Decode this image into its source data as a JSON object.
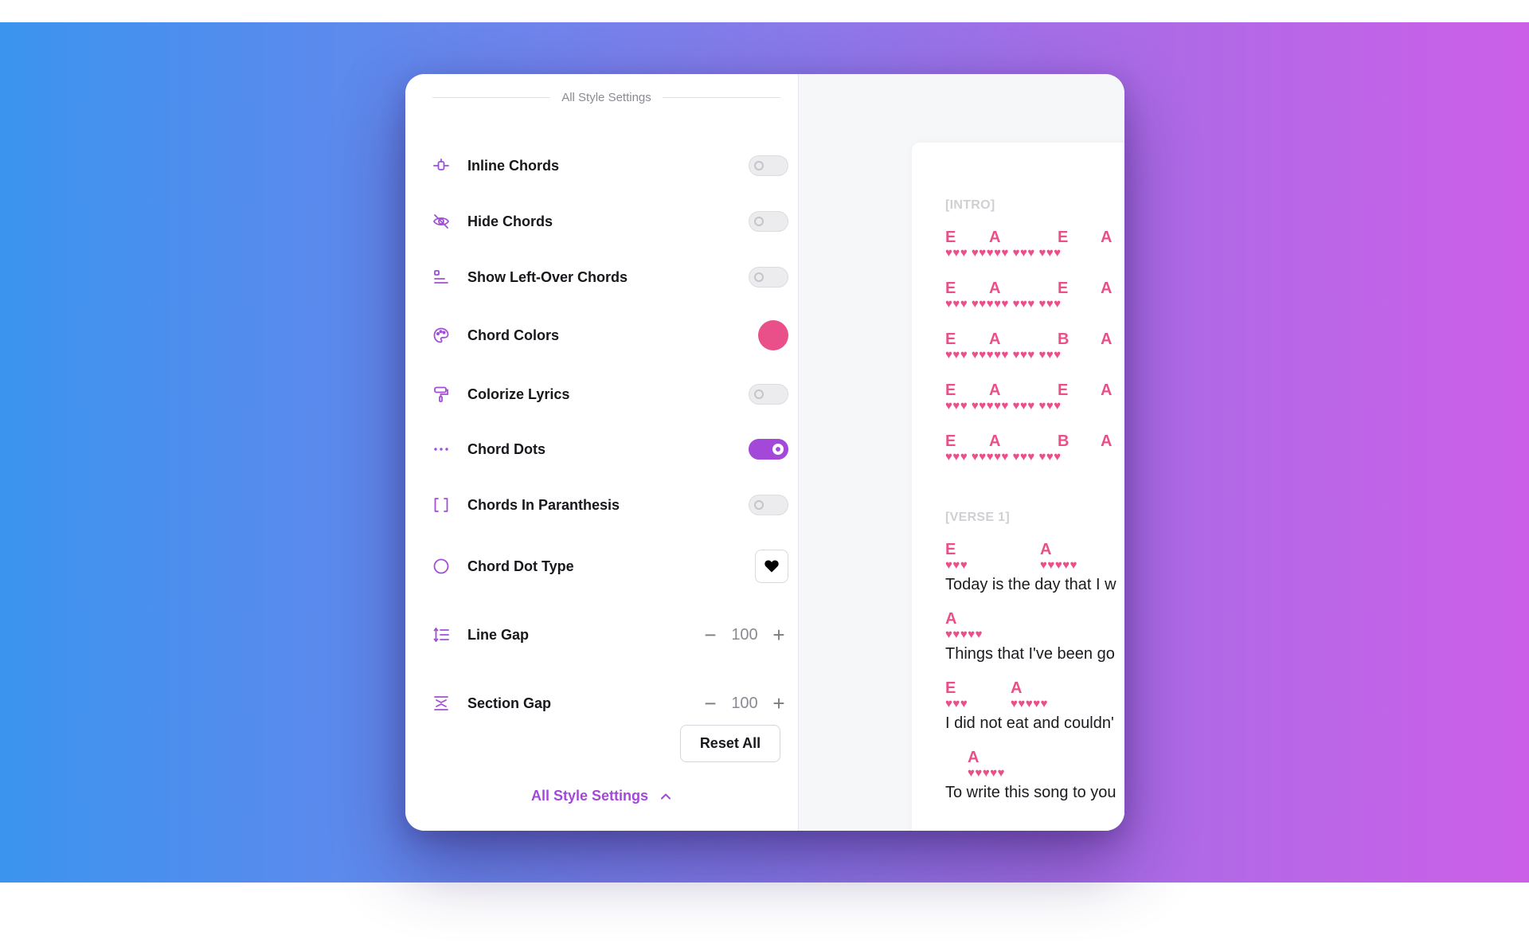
{
  "panel": {
    "header_title": "All Style Settings",
    "rows": [
      {
        "label": "Inline Chords",
        "icon": "inline-chords-icon",
        "control": "toggle",
        "on": false
      },
      {
        "label": "Hide Chords",
        "icon": "eye-off-icon",
        "control": "toggle",
        "on": false
      },
      {
        "label": "Show Left-Over Chords",
        "icon": "align-left-icon",
        "control": "toggle",
        "on": false
      },
      {
        "label": "Chord Colors",
        "icon": "palette-icon",
        "control": "color",
        "color": "#e94f88"
      },
      {
        "label": "Colorize Lyrics",
        "icon": "paint-roller-icon",
        "control": "toggle",
        "on": false
      },
      {
        "label": "Chord Dots",
        "icon": "dots-icon",
        "control": "toggle",
        "on": true
      },
      {
        "label": "Chords In Paranthesis",
        "icon": "brackets-icon",
        "control": "toggle",
        "on": false
      },
      {
        "label": "Chord Dot Type",
        "icon": "circle-icon",
        "control": "dot-type",
        "dot_symbol": "heart"
      },
      {
        "label": "Line Gap",
        "icon": "line-gap-icon",
        "control": "stepper",
        "value": "100"
      },
      {
        "label": "Section Gap",
        "icon": "section-gap-icon",
        "control": "stepper",
        "value": "100"
      }
    ],
    "reset_label": "Reset All",
    "footer_label": "All Style Settings"
  },
  "preview": {
    "sections": [
      {
        "label": "[INTRO]"
      },
      {
        "label": "[VERSE 1]"
      }
    ],
    "intro_lines": [
      {
        "chords": [
          "E",
          "A",
          "E",
          "A"
        ]
      },
      {
        "chords": [
          "E",
          "A",
          "E",
          "A"
        ]
      },
      {
        "chords": [
          "E",
          "A",
          "B",
          "A"
        ]
      },
      {
        "chords": [
          "E",
          "A",
          "E",
          "A"
        ]
      },
      {
        "chords": [
          "E",
          "A",
          "B",
          "A"
        ]
      }
    ],
    "verse_lines": [
      {
        "chords": [
          "E",
          "A"
        ],
        "lyric": "Today is the day that I w"
      },
      {
        "chords": [
          "A"
        ],
        "lyric": "Things that I've been go"
      },
      {
        "chords": [
          "E",
          "A"
        ],
        "lyric": "I did not eat and couldn'"
      },
      {
        "chords": [
          "A"
        ],
        "lyric": "To write this song to you"
      }
    ]
  },
  "colors": {
    "accent": "#a348d9",
    "chord": "#e94f88",
    "background_gradient": [
      "#3b94ee",
      "#cc5fe8"
    ]
  }
}
